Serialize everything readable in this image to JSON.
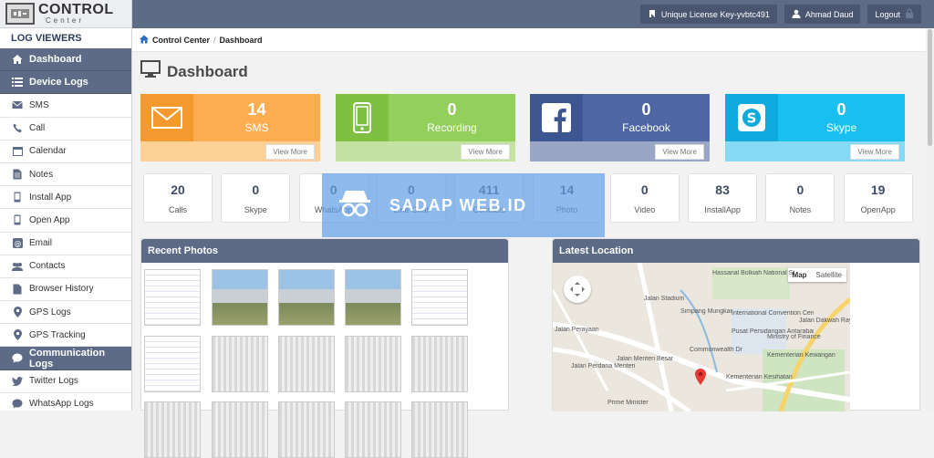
{
  "logo": {
    "line1": "CONTROL",
    "line2": "Center"
  },
  "sidebar": {
    "section_label": "LOG VIEWERS",
    "items": [
      {
        "label": "Dashboard",
        "icon": "home-icon",
        "header": true
      },
      {
        "label": "Device Logs",
        "icon": "list-icon",
        "header": true
      },
      {
        "label": "SMS",
        "icon": "envelope-icon"
      },
      {
        "label": "Call",
        "icon": "phone-icon"
      },
      {
        "label": "Calendar",
        "icon": "calendar-icon"
      },
      {
        "label": "Notes",
        "icon": "note-icon"
      },
      {
        "label": "Install App",
        "icon": "mobile-icon"
      },
      {
        "label": "Open App",
        "icon": "mobile-icon"
      },
      {
        "label": "Email",
        "icon": "at-icon"
      },
      {
        "label": "Contacts",
        "icon": "users-icon"
      },
      {
        "label": "Browser History",
        "icon": "document-icon"
      },
      {
        "label": "GPS Logs",
        "icon": "map-marker-icon"
      },
      {
        "label": "GPS Tracking",
        "icon": "map-marker-icon"
      },
      {
        "label": "Communication Logs",
        "icon": "chat-icon",
        "header": true
      },
      {
        "label": "Twitter Logs",
        "icon": "twitter-icon"
      },
      {
        "label": "WhatsApp Logs",
        "icon": "chat-icon"
      }
    ]
  },
  "topbar": {
    "license": "Unique License Key-yvbtc491",
    "user": "Ahmad Daud",
    "logout": "Logout"
  },
  "breadcrumb": {
    "root": "Control Center",
    "sep": "/",
    "current": "Dashboard"
  },
  "page_title": "Dashboard",
  "tiles": [
    {
      "num": "14",
      "label": "SMS",
      "icon": "envelope-icon",
      "color": "#fdac4f",
      "dark": "#f59a2f",
      "light": "#fdd095",
      "view": "View More"
    },
    {
      "num": "0",
      "label": "Recording",
      "icon": "mobile-icon",
      "color": "#93cf5b",
      "dark": "#7fc043",
      "light": "#c4e3a3",
      "view": "View More"
    },
    {
      "num": "0",
      "label": "Facebook",
      "icon": "facebook-icon",
      "color": "#4e66a4",
      "dark": "#3d5590",
      "light": "#9aa6c6",
      "view": "View More"
    },
    {
      "num": "0",
      "label": "Skype",
      "icon": "skype-icon",
      "color": "#19bfef",
      "dark": "#0faadd",
      "light": "#86daf5",
      "view": "View More"
    }
  ],
  "stats": [
    {
      "value": "20",
      "label": "Calls"
    },
    {
      "value": "0",
      "label": "Skype"
    },
    {
      "value": "0",
      "label": "WhatsApp"
    },
    {
      "value": "0",
      "label": "Line Chat"
    },
    {
      "value": "411",
      "label": "Contacts"
    },
    {
      "value": "14",
      "label": "Photo"
    },
    {
      "value": "0",
      "label": "Video"
    },
    {
      "value": "83",
      "label": "InstallApp"
    },
    {
      "value": "0",
      "label": "Notes"
    },
    {
      "value": "19",
      "label": "OpenApp"
    }
  ],
  "watermark": "SADAP WEB.ID",
  "recent_photos": {
    "title": "Recent Photos"
  },
  "latest_location": {
    "title": "Latest Location",
    "map_btn": "Map",
    "satellite_btn": "Satellite",
    "labels": [
      "Hassanal Bolkiah National Stadium",
      "Jalan Stadium",
      "International Convention Centre",
      "Pusat Persidangan Antarabangsa",
      "Ministry of Finance",
      "Kementerian Kewangan",
      "Kementerian Kesihatan",
      "Jalan Menteri Besar",
      "Prime Minister",
      "Jalan Perdana Menteri",
      "Jalan Dakwah Raya",
      "Jalan Perayaan",
      "Commonwealth Dr",
      "Simpang Mungkar"
    ]
  }
}
